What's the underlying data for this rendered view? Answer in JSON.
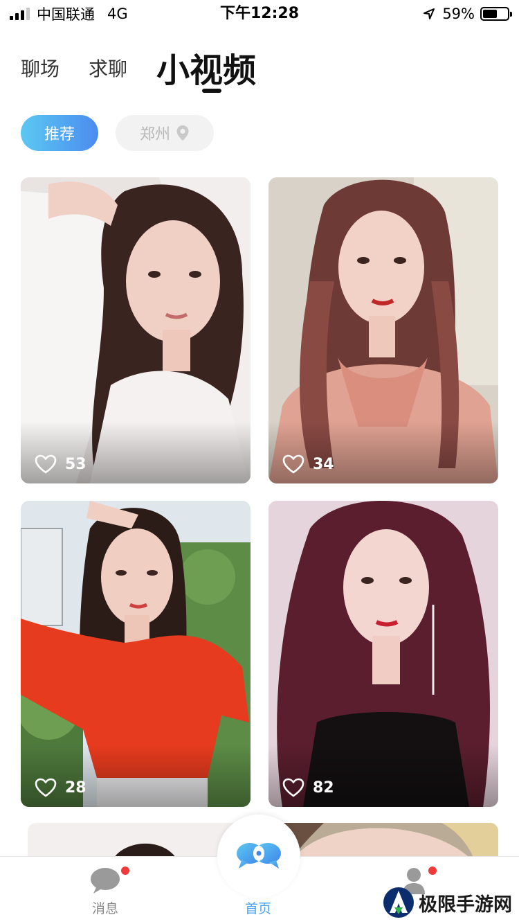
{
  "status_bar": {
    "carrier": "中国联通",
    "network": "4G",
    "time": "下午12:28",
    "battery_percent": "59%",
    "battery_level": 0.59
  },
  "tabs": {
    "chat": "聊场",
    "ask": "求聊",
    "video": "小视频",
    "active": "video"
  },
  "filters": {
    "recommend": "推荐",
    "city": "郑州"
  },
  "videos": [
    {
      "likes": "53"
    },
    {
      "likes": "34"
    },
    {
      "likes": "28"
    },
    {
      "likes": "82"
    }
  ],
  "bottom_nav": {
    "messages": "消息",
    "home": "首页",
    "home_active": true
  },
  "colors": {
    "accent": "#4a8cf0",
    "accent_light": "#5cc8f2",
    "badge": "#f03a3a"
  },
  "watermark": {
    "text": "极限手游网"
  }
}
